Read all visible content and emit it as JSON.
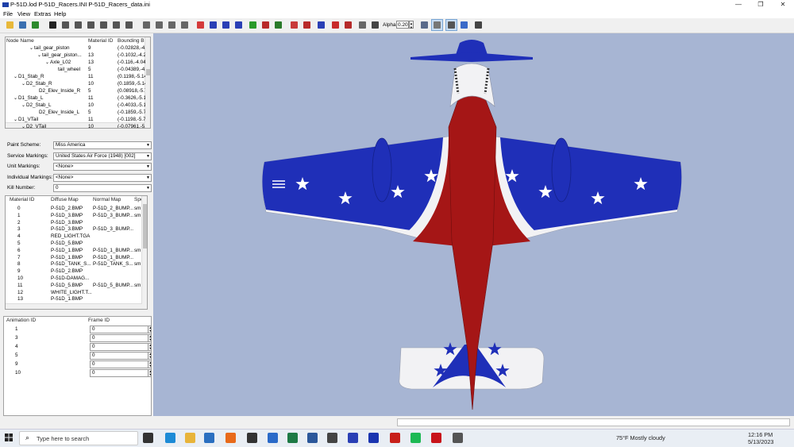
{
  "window": {
    "title": "P-51D.lod  P-51D_Racers.INI  P-51D_Racers_data.ini",
    "minimize": "—",
    "maximize": "❐",
    "close": "✕"
  },
  "menu": [
    "File",
    "View",
    "Extras",
    "Help"
  ],
  "toolbar": {
    "alpha_label": "Alpha:",
    "alpha_value": "0.20",
    "icons": [
      "open-icon",
      "save-icon",
      "text-icon",
      "crosshair-icon",
      "box-icon",
      "box-icon",
      "box-icon",
      "box-icon",
      "box-icon",
      "box-icon",
      "cube-icon",
      "cube-icon",
      "cube-icon",
      "cube-icon",
      "cube-icon",
      "cube-icon",
      "cube-icon",
      "cube-icon",
      "cube-icon",
      "cube-icon",
      "cube-icon",
      "cube-icon",
      "cube-icon",
      "cube-icon",
      "cube-icon",
      "cube-icon",
      "cube-icon",
      "cube-icon",
      "cube-icon",
      "cube-icon",
      "cube-icon",
      "graph-icon",
      "copy-icon",
      "tools-icon"
    ],
    "icon_colors": [
      "#e8b83a",
      "#3a6fb0",
      "#2d8a2d",
      "#222222",
      "#555555",
      "#555555",
      "#555555",
      "#555555",
      "#555555",
      "#555555",
      "#666666",
      "#666666",
      "#666666",
      "#666666",
      "#d43a3a",
      "#2a3fb5",
      "#2a3fb5",
      "#2a3fb5",
      "#2a9a2a",
      "#b82a2a",
      "#2a7a2a",
      "#c83a3a",
      "#b82a2a",
      "#2a3fb5",
      "#c82a2a",
      "#b52a2a",
      "#666666",
      "#444444",
      "#5a6a8a",
      "#777777",
      "#555555",
      "#3a6ac8",
      "#444444",
      "#b83030"
    ]
  },
  "node_tree": {
    "headers": [
      "Node Name",
      "Material ID",
      "Bounding B"
    ],
    "rows": [
      {
        "expander": "⌄",
        "name": "tail_gear_piston",
        "mat": "9",
        "bb": "(-0.02828,-4."
      },
      {
        "expander": "⌄",
        "name": "tail_gear_piston...",
        "mat": "13",
        "bb": "(-0.1032,-4.2"
      },
      {
        "expander": "⌄",
        "name": "Axle_L02",
        "mat": "13",
        "bb": "(-0.116,-4.04"
      },
      {
        "expander": "",
        "name": "tail_wheel",
        "mat": "5",
        "bb": "(-0.04389,-4."
      },
      {
        "expander": "⌄",
        "name": "D1_Stab_R",
        "mat": "11",
        "bb": "(0.1198,-5.14"
      },
      {
        "expander": "⌄",
        "name": "D2_Stab_R",
        "mat": "10",
        "bb": "(0.1859,-5.14"
      },
      {
        "expander": "",
        "name": "D2_Elev_Inside_R",
        "mat": "5",
        "bb": "(0.08918,-5.7"
      },
      {
        "expander": "⌄",
        "name": "D1_Stab_L",
        "mat": "11",
        "bb": "(-0.3626,-5.1"
      },
      {
        "expander": "⌄",
        "name": "D2_Stab_L",
        "mat": "10",
        "bb": "(-0.4033,-5.1"
      },
      {
        "expander": "",
        "name": "D2_Elev_Inside_L",
        "mat": "5",
        "bb": "(-0.1859,-5.7"
      },
      {
        "expander": "⌄",
        "name": "D1_VTail",
        "mat": "11",
        "bb": "(-0.1198,-5.7"
      },
      {
        "expander": "⌄",
        "name": "D2_VTail",
        "mat": "10",
        "bb": "(-0.07961,-5."
      }
    ]
  },
  "properties": [
    {
      "label": "Paint Scheme:",
      "value": "Miss America"
    },
    {
      "label": "Service Markings:",
      "value": "United States Air Force (1948) [002]"
    },
    {
      "label": "Unit Markings:",
      "value": "<None>"
    },
    {
      "label": "Individual Markings:",
      "value": "<None>"
    },
    {
      "label": "Kill Number:",
      "value": "0"
    }
  ],
  "materials": {
    "headers": [
      "Material ID",
      "Diffuse Map",
      "Normal Map",
      "Spe"
    ],
    "rows": [
      {
        "id": "0",
        "diffuse": "P-51D_2.BMP",
        "normal": "P-51D_2_BUMP....",
        "spec": "sm"
      },
      {
        "id": "1",
        "diffuse": "P-51D_3.BMP",
        "normal": "P-51D_3_BUMP....",
        "spec": "sm"
      },
      {
        "id": "2",
        "diffuse": "P-51D_3.BMP",
        "normal": "",
        "spec": ""
      },
      {
        "id": "3",
        "diffuse": "P-51D_3.BMP",
        "normal": "P-51D_3_BUMP....",
        "spec": ""
      },
      {
        "id": "4",
        "diffuse": "RED_LIGHT.TGA",
        "normal": "",
        "spec": ""
      },
      {
        "id": "5",
        "diffuse": "P-51D_5.BMP",
        "normal": "",
        "spec": ""
      },
      {
        "id": "6",
        "diffuse": "P-51D_1.BMP",
        "normal": "P-51D_1_BUMP....",
        "spec": "sm"
      },
      {
        "id": "7",
        "diffuse": "P-51D_1.BMP",
        "normal": "P-51D_1_BUMP....",
        "spec": ""
      },
      {
        "id": "8",
        "diffuse": "P-51D_TANK_S...",
        "normal": "P-51D_TANK_S...",
        "spec": "sm"
      },
      {
        "id": "9",
        "diffuse": "P-51D_2.BMP",
        "normal": "",
        "spec": ""
      },
      {
        "id": "10",
        "diffuse": "P-51D-DAMAG...",
        "normal": "",
        "spec": ""
      },
      {
        "id": "11",
        "diffuse": "P-51D_5.BMP",
        "normal": "P-51D_5_BUMP....",
        "spec": "sm"
      },
      {
        "id": "12",
        "diffuse": "WHITE_LIGHT.T...",
        "normal": "",
        "spec": ""
      },
      {
        "id": "13",
        "diffuse": "P-51D_1.BMP",
        "normal": "",
        "spec": ""
      }
    ]
  },
  "animation": {
    "headers": [
      "Animation ID",
      "Frame ID"
    ],
    "rows": [
      {
        "id": "1",
        "frame": "0"
      },
      {
        "id": "3",
        "frame": "0"
      },
      {
        "id": "4",
        "frame": "0"
      },
      {
        "id": "5",
        "frame": "0"
      },
      {
        "id": "9",
        "frame": "0"
      },
      {
        "id": "10",
        "frame": "0"
      }
    ]
  },
  "viewport": {
    "background": "#a7b5d3",
    "paint_colors": {
      "blue": "#1f2fb8",
      "red": "#a51616",
      "white": "#f2f2f4"
    }
  },
  "taskbar": {
    "search_placeholder": "Type here to search",
    "search_badge": "",
    "app_icons": [
      "taskview-icon",
      "edge-icon",
      "file-explorer-icon",
      "store-icon",
      "firefox-icon",
      "notepad-icon",
      "mail-icon",
      "excel-icon",
      "word-icon",
      "snip-icon",
      "app-icon",
      "app-icon",
      "acrobat-icon",
      "spotify-icon",
      "mcafee-icon",
      "settings-icon"
    ],
    "app_colors": [
      "#333333",
      "#1d8bd6",
      "#e8b43a",
      "#2a6fc0",
      "#e86a1a",
      "#333333",
      "#2a6ac8",
      "#1e7a45",
      "#2b579a",
      "#444444",
      "#2a3fb5",
      "#1a35b0",
      "#c8201a",
      "#1db954",
      "#c8141a",
      "#555555"
    ],
    "weather": "75°F  Mostly cloudy",
    "time": "12:16 PM",
    "date": "5/13/2023"
  }
}
